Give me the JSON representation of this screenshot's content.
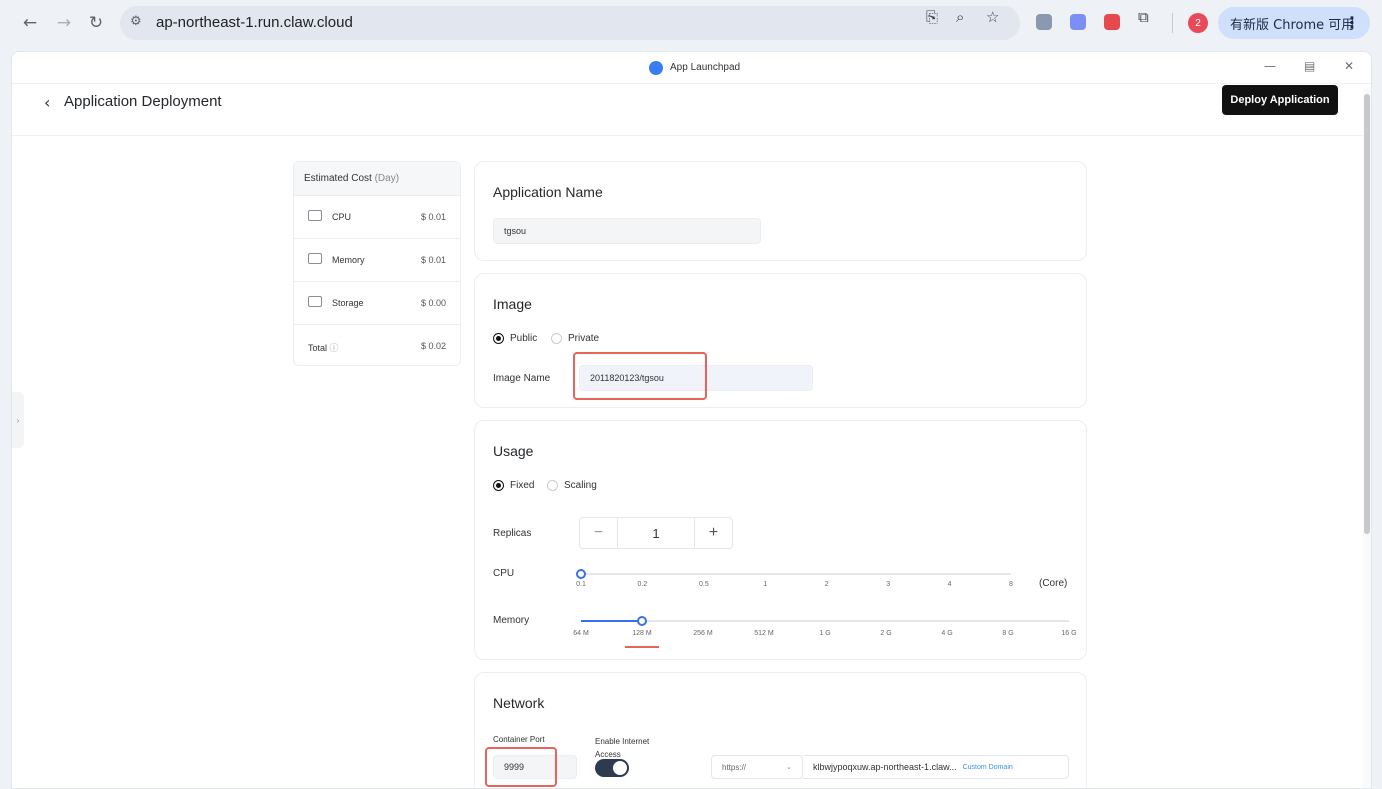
{
  "browser": {
    "url": "ap-northeast-1.run.claw.cloud",
    "update_label": "有新版 Chrome 可用",
    "profile_badge": "2"
  },
  "window": {
    "app_title": "App Launchpad"
  },
  "header": {
    "title": "Application Deployment",
    "deploy_label": "Deploy Application"
  },
  "cost": {
    "title": "Estimated Cost",
    "unit": "(Day)",
    "rows": [
      {
        "label": "CPU",
        "value": "$ 0.01"
      },
      {
        "label": "Memory",
        "value": "$ 0.01"
      },
      {
        "label": "Storage",
        "value": "$ 0.00"
      }
    ],
    "total_label": "Total",
    "total_value": "$ 0.02"
  },
  "app_name": {
    "heading": "Application Name",
    "value": "tgsou"
  },
  "image": {
    "heading": "Image",
    "public_label": "Public",
    "private_label": "Private",
    "selected": "Public",
    "name_label": "Image Name",
    "name_value": "2011820123/tgsou"
  },
  "usage": {
    "heading": "Usage",
    "fixed_label": "Fixed",
    "scaling_label": "Scaling",
    "selected": "Fixed",
    "replicas_label": "Replicas",
    "replicas_value": "1",
    "cpu_label": "CPU",
    "cpu_unit": "(Core)",
    "cpu_ticks": [
      "0.1",
      "0.2",
      "0.5",
      "1",
      "2",
      "3",
      "4",
      "8"
    ],
    "cpu_selected_index": 0,
    "memory_label": "Memory",
    "memory_ticks": [
      "64 M",
      "128 M",
      "256 M",
      "512 M",
      "1 G",
      "2 G",
      "4 G",
      "8 G",
      "16 G"
    ],
    "memory_selected_index": 1
  },
  "network": {
    "heading": "Network",
    "port_label": "Container Port",
    "port_value": "9999",
    "internet_label": "Enable Internet Access",
    "internet_enabled": true,
    "protocol": "https://",
    "domain": "klbwjypoqxuw.ap-northeast-1.claw...",
    "custom_domain_label": "Custom Domain"
  }
}
